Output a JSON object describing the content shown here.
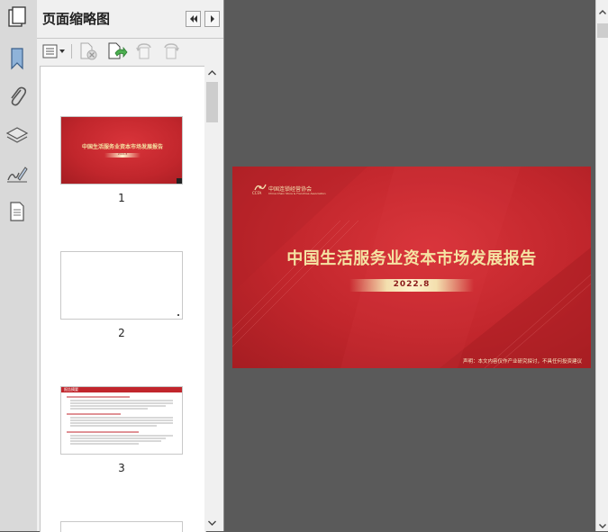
{
  "panel": {
    "title": "页面缩略图"
  },
  "thumbnails": [
    {
      "label": "1",
      "title_text": "中国生活服务业资本市场发展报告",
      "date_text": "2022.8"
    },
    {
      "label": "2"
    },
    {
      "label": "3",
      "heading_text": "报告摘要"
    }
  ],
  "slide": {
    "logo_cn": "中国连锁经营协会",
    "logo_en": "China Chain Store & Franchise Association",
    "logo_abbr": "CCFA",
    "title": "中国生活服务业资本市场发展报告",
    "date": "2022.8",
    "note": "声明：本文内容仅作产业研究探讨，不具任何投资建议"
  },
  "colors": {
    "slide_red": "#c1262c",
    "title_gold": "#f5e3a3",
    "viewer_bg": "#5a5a5a"
  },
  "icons": {
    "rail": [
      "bookmark-icon",
      "attachment-icon",
      "layers-icon",
      "signature-icon",
      "page-icon"
    ],
    "toolbar": [
      "options-menu-icon",
      "delete-page-icon",
      "extract-page-icon",
      "rotate-ccw-icon",
      "rotate-cw-icon"
    ]
  }
}
